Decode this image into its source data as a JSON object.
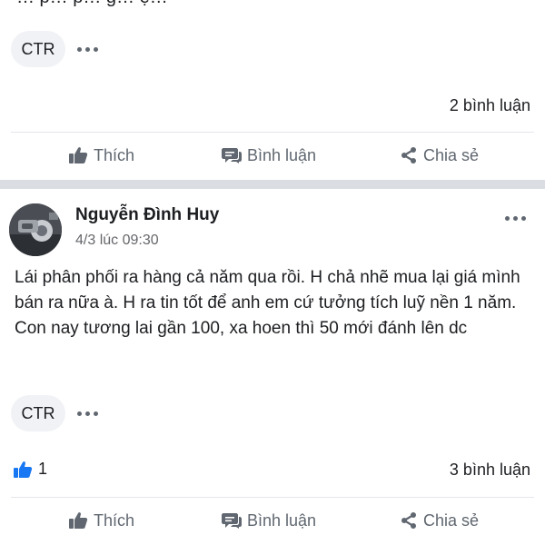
{
  "post1": {
    "text_cut": "… p… p… g… ệ…",
    "tag": "CTR",
    "comments": "2 bình luận"
  },
  "post2": {
    "author": "Nguyễn Đình Huy",
    "timestamp": "4/3 lúc 09:30",
    "text": "Lái phân phối ra hàng cả năm qua rồi. H chả nhẽ mua lại giá mình bán ra nữa à. H ra tin tốt để anh em cứ tưởng tích luỹ nền 1 năm. Con nay tương lai gần 100, xa hoen thì 50 mới đánh lên dc",
    "tag": "CTR",
    "likes": "1",
    "comments": "3 bình luận"
  },
  "actions": {
    "like": "Thích",
    "comment": "Bình luận",
    "share": "Chia sẻ"
  },
  "icons": {
    "like": "thumbs-up-icon",
    "comment": "comment-bubble-icon",
    "share": "share-icon",
    "more": "more-dots-icon"
  },
  "colors": {
    "like_blue": "#1877f2",
    "action_gray": "#606770",
    "separator": "#dadde1"
  }
}
